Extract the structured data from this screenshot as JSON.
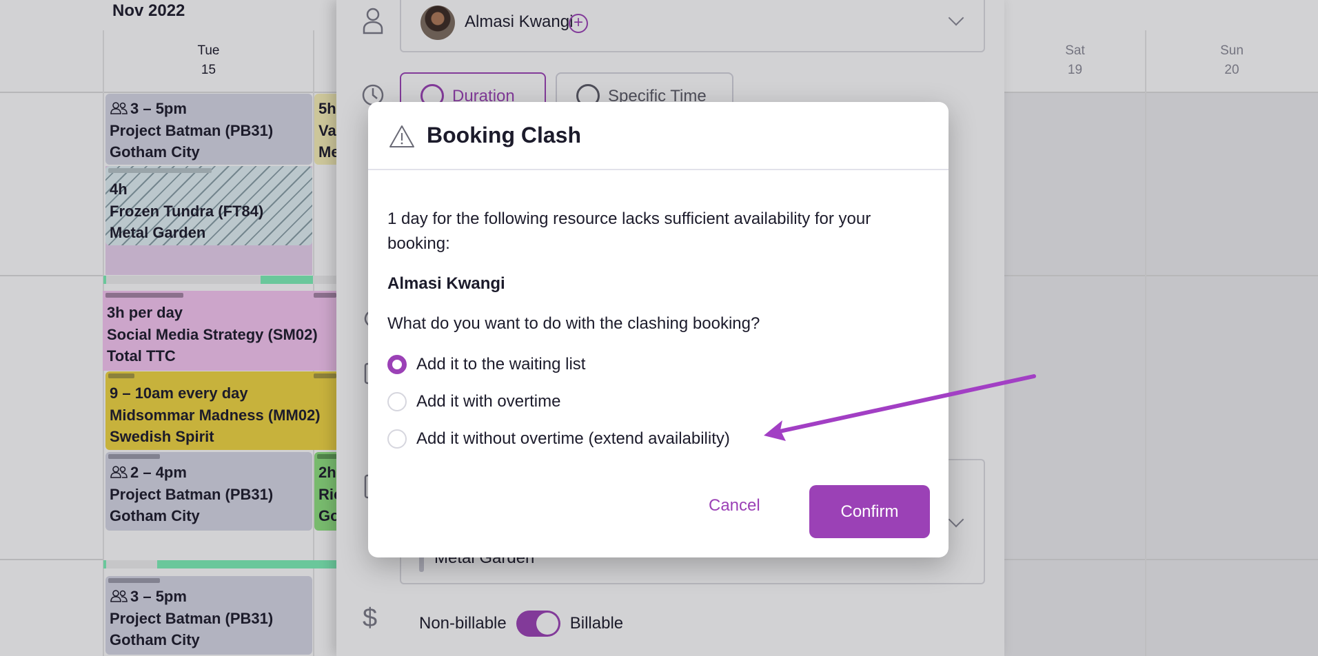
{
  "calendar": {
    "month": "Nov 2022",
    "days": [
      {
        "dow": "Tue",
        "date": "15"
      },
      {
        "dow": "Sat",
        "date": "19"
      },
      {
        "dow": "Sun",
        "date": "20"
      }
    ],
    "events": [
      {
        "lines": [
          "3 – 5pm",
          "Project Batman (PB31)",
          "Gotham City"
        ],
        "group": true
      },
      {
        "lines": [
          "4h",
          "Frozen Tundra (FT84)",
          "Metal Garden"
        ],
        "group": false
      },
      {
        "lines": [
          "3h per day",
          "Social Media Strategy (SM02)",
          "Total TTC"
        ],
        "group": false
      },
      {
        "lines": [
          "9 – 10am every day",
          "Midsommar Madness (MM02)",
          "Swedish Spirit"
        ],
        "group": false
      },
      {
        "lines": [
          "2 – 4pm",
          "Project Batman (PB31)",
          "Gotham City"
        ],
        "group": true
      },
      {
        "lines": [
          "3 – 5pm",
          "Project Batman (PB31)",
          "Gotham City"
        ],
        "group": true
      }
    ],
    "partial_events": [
      {
        "lines": [
          "5h",
          "Va",
          "Me"
        ]
      },
      {
        "lines": [
          "2h",
          "Ric",
          "Go"
        ]
      }
    ]
  },
  "panel": {
    "resource_name": "Almasi Kwangi",
    "mode_tabs": [
      {
        "label": "Duration",
        "active": true
      },
      {
        "label": "Specific Time",
        "active": false
      }
    ],
    "project_client": "Metal Garden",
    "billing": {
      "left_label": "Non-billable",
      "right_label": "Billable",
      "billable": true
    }
  },
  "modal": {
    "title": "Booking Clash",
    "message": "1 day for the following resource lacks sufficient availability for your booking:",
    "resource": "Almasi Kwangi",
    "question": "What do you want to do with the clashing booking?",
    "options": [
      {
        "label": "Add it to the waiting list",
        "selected": true
      },
      {
        "label": "Add it with overtime",
        "selected": false
      },
      {
        "label": "Add it without overtime (extend availability)",
        "selected": false
      }
    ],
    "cancel_label": "Cancel",
    "confirm_label": "Confirm"
  },
  "colors": {
    "accent": "#9b41b6",
    "annotation_arrow": "#a23fc4"
  }
}
